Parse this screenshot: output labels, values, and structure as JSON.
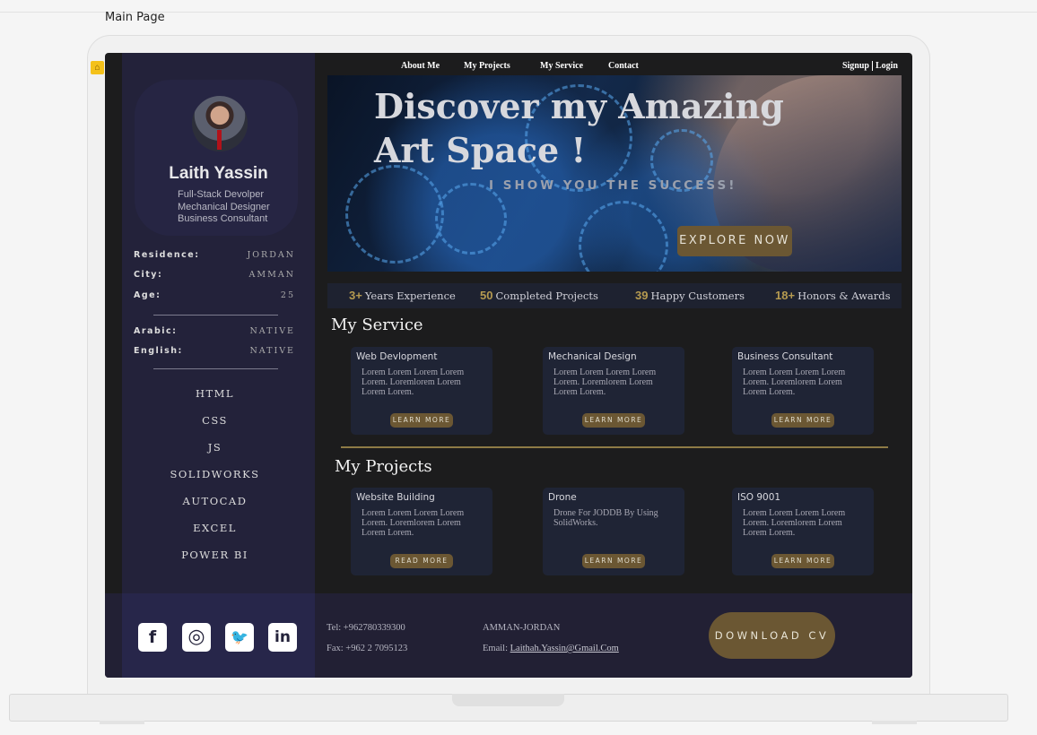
{
  "frame": {
    "title": "Main Page"
  },
  "nav": {
    "items": [
      "About Me",
      "My Projects",
      "My Service",
      "Contact"
    ],
    "signup": "Signup",
    "login": "Login"
  },
  "profile": {
    "name": "Laith Yassin",
    "roles": [
      "Full-Stack Devolper",
      "Mechanical Designer",
      "Business Consultant"
    ],
    "info": [
      {
        "label": "Residence:",
        "value": "JORDAN"
      },
      {
        "label": "City:",
        "value": "AMMAN"
      },
      {
        "label": "Age:",
        "value": "25"
      }
    ],
    "languages": [
      {
        "label": "Arabic:",
        "value": "NATIVE"
      },
      {
        "label": "English:",
        "value": "NATIVE"
      }
    ],
    "skills": [
      "HTML",
      "CSS",
      "JS",
      "SOLIDWORKS",
      "AUTOCAD",
      "EXCEL",
      "POWER BI"
    ]
  },
  "hero": {
    "title_line1": "Discover my Amazing",
    "title_line2": "Art Space !",
    "tagline": "I SHOW YOU THE SUCCESS!",
    "cta": "EXPLORE NOW"
  },
  "stats": [
    {
      "num": "3+",
      "label": "Years Experience"
    },
    {
      "num": "50",
      "label": "Completed Projects"
    },
    {
      "num": "39",
      "label": "Happy Customers"
    },
    {
      "num": "18+",
      "label": "Honors & Awards"
    }
  ],
  "services": {
    "title": "My  Service",
    "cards": [
      {
        "title": "Web Devlopment",
        "desc": "Lorem Lorem Lorem Lorem Lorem. Loremlorem Lorem Lorem Lorem.",
        "button": "LEARN MORE"
      },
      {
        "title": "Mechanical Design",
        "desc": "Lorem Lorem Lorem Lorem Lorem. Loremlorem Lorem Lorem Lorem.",
        "button": "LEARN MORE"
      },
      {
        "title": "Business Consultant",
        "desc": "Lorem Lorem Lorem Lorem Lorem. Loremlorem Lorem Lorem Lorem.",
        "button": "LEARN MORE"
      }
    ]
  },
  "projects": {
    "title": "My  Projects",
    "cards": [
      {
        "title": "Website Building",
        "desc": "Lorem Lorem Lorem Lorem Lorem. Loremlorem Lorem Lorem Lorem.",
        "button": "READ MORE"
      },
      {
        "title": "Drone",
        "desc": "Drone For JODDB By Using SolidWorks.",
        "button": "LEARN MORE"
      },
      {
        "title": "ISO 9001",
        "desc": "Lorem Lorem Lorem Lorem Lorem. Loremlorem Lorem Lorem Lorem.",
        "button": "LEARN MORE"
      }
    ]
  },
  "footer": {
    "social": [
      {
        "icon": "facebook-icon",
        "glyph": "f"
      },
      {
        "icon": "instagram-icon",
        "glyph": "◎"
      },
      {
        "icon": "twitter-icon",
        "glyph": "🐦"
      },
      {
        "icon": "linkedin-icon",
        "glyph": "in"
      }
    ],
    "tel": "Tel: +962780339300",
    "fax": "Fax: +962 2 7095123",
    "location": "AMMAN-JORDAN",
    "email_label": "Email: ",
    "email": "Laithah.Yassin@Gmail.Com",
    "download": "DOWNLOAD CV"
  },
  "colors": {
    "accent": "#6b5733",
    "gold": "#b59a50",
    "sidebar": "#23223a",
    "background": "#1c1c1d"
  }
}
